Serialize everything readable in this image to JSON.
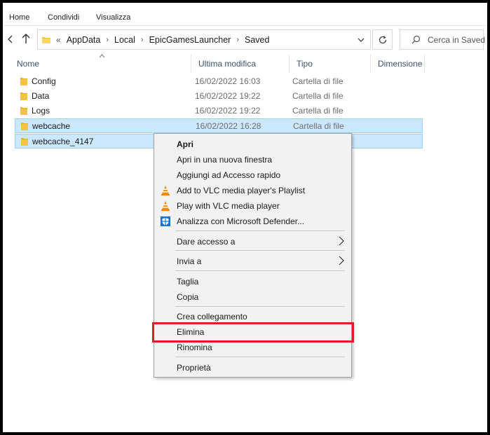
{
  "ribbon": {
    "tabs": [
      "Home",
      "Condividi",
      "Visualizza"
    ]
  },
  "address": {
    "lead": "«",
    "crumbs": [
      "AppData",
      "Local",
      "EpicGamesLauncher",
      "Saved"
    ],
    "separator": "›"
  },
  "search": {
    "placeholder": "Cerca in Saved"
  },
  "columns": {
    "name": "Nome",
    "modified": "Ultima modifica",
    "type": "Tipo",
    "size": "Dimensione"
  },
  "files": [
    {
      "name": "Config",
      "modified": "16/02/2022 16:03",
      "type": "Cartella di file",
      "selected": false
    },
    {
      "name": "Data",
      "modified": "16/02/2022 19:22",
      "type": "Cartella di file",
      "selected": false
    },
    {
      "name": "Logs",
      "modified": "16/02/2022 19:22",
      "type": "Cartella di file",
      "selected": false
    },
    {
      "name": "webcache",
      "modified": "16/02/2022 16:28",
      "type": "Cartella di file",
      "selected": true
    },
    {
      "name": "webcache_4147",
      "modified": "",
      "type": "",
      "selected": true
    }
  ],
  "context_menu": {
    "open": "Apri",
    "open_new_window": "Apri in una nuova finestra",
    "add_quick_access": "Aggiungi ad Accesso rapido",
    "vlc_playlist": "Add to VLC media player's Playlist",
    "vlc_play": "Play with VLC media player",
    "defender_scan": "Analizza con Microsoft Defender...",
    "give_access": "Dare accesso a",
    "send_to": "Invia a",
    "cut": "Taglia",
    "copy": "Copia",
    "create_shortcut": "Crea collegamento",
    "delete": "Elimina",
    "rename": "Rinomina",
    "properties": "Proprietà"
  },
  "colors": {
    "selection_bg": "#cce8ff",
    "selection_border": "#99d1ff",
    "highlight_box": "#dc1f26",
    "folder_yellow": "#f6c244",
    "vlc_orange": "#f08a00",
    "defender_blue": "#1877d6"
  }
}
